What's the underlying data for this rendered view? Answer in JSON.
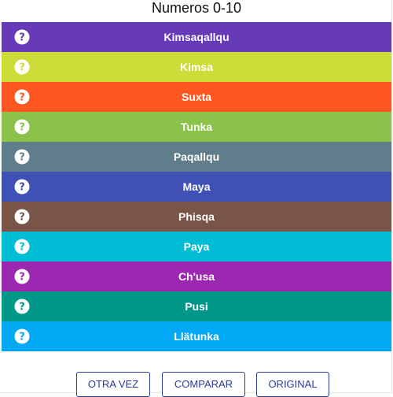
{
  "title": "Numeros 0-10",
  "icon": "question-circle-icon",
  "rows": [
    {
      "label": "Kimsaqallqu",
      "color": "#673ab7"
    },
    {
      "label": "Kimsa",
      "color": "#cddc39"
    },
    {
      "label": "Suxta",
      "color": "#ff5722"
    },
    {
      "label": "Tunka",
      "color": "#8bc34a"
    },
    {
      "label": "Paqallqu",
      "color": "#607d8b"
    },
    {
      "label": "Maya",
      "color": "#3f51b5"
    },
    {
      "label": "Phisqa",
      "color": "#795548"
    },
    {
      "label": "Paya",
      "color": "#00bcd4"
    },
    {
      "label": "Ch'usa",
      "color": "#9c27b0"
    },
    {
      "label": "Pusi",
      "color": "#009688"
    },
    {
      "label": "Llätunka",
      "color": "#03a9f4"
    }
  ],
  "buttons": {
    "again": "OTRA VEZ",
    "compare": "COMPARAR",
    "original": "ORIGINAL"
  },
  "colors": {
    "button_text": "#2a3a9e",
    "button_border": "#2a3a9e"
  }
}
